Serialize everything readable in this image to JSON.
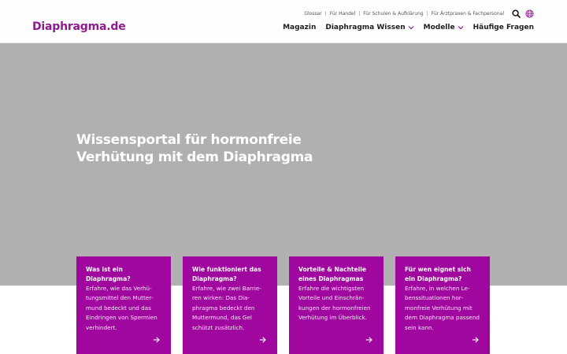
{
  "header": {
    "logo": "Diaphragma.de",
    "util_links": [
      {
        "label": "Glossar"
      },
      {
        "label": "Für Handel"
      },
      {
        "label": "Für Schulen & Aufklärung"
      },
      {
        "label": "Für Ärztpraxen & Fachpersonal"
      }
    ],
    "util_separator": "|",
    "icons": {
      "search": "search-icon",
      "language": "globe-icon"
    },
    "nav": [
      {
        "label": "Magazin",
        "dropdown": false
      },
      {
        "label": "Diaphragma Wissen",
        "dropdown": true
      },
      {
        "label": "Modelle",
        "dropdown": true
      },
      {
        "label": "Häufige Fragen",
        "dropdown": false
      }
    ]
  },
  "hero": {
    "title_line1": "Wissensportal für hormonfreie",
    "title_line2": "Verhütung mit dem Diaphragma"
  },
  "cards": [
    {
      "title": "Was ist ein Diaphragma?",
      "text": "Erfahre, wie das Verhü­tungsmittel den Mutter­mund bedeckt und das Eindringen von Sper­mien verhindert."
    },
    {
      "title": "Wie funktioniert das Diaphragma?",
      "text": "Erfahre, wie zwei Barrie­ren wirken: Das Dia­phragma bedeckt den Muttermund, das Gel schützt zusätzlich."
    },
    {
      "title": "Vorteile & Nachteile eines Diaphragmas",
      "text": "Erfahre die wichtigsten Vorteile und Einschrän­kungen der hormon­freien Verhütung im Überblick."
    },
    {
      "title": "Für wen eignet sich ein Diaphragma?",
      "text": "Erfahre, in welchen Le­benssituationen hor­monfreie Verhütung mit dem Diaphragma pas­send sein kann."
    }
  ],
  "colors": {
    "brand": "#8d1a8f",
    "card_background": "#a0079f",
    "hero_background": "#b0b0b0"
  }
}
